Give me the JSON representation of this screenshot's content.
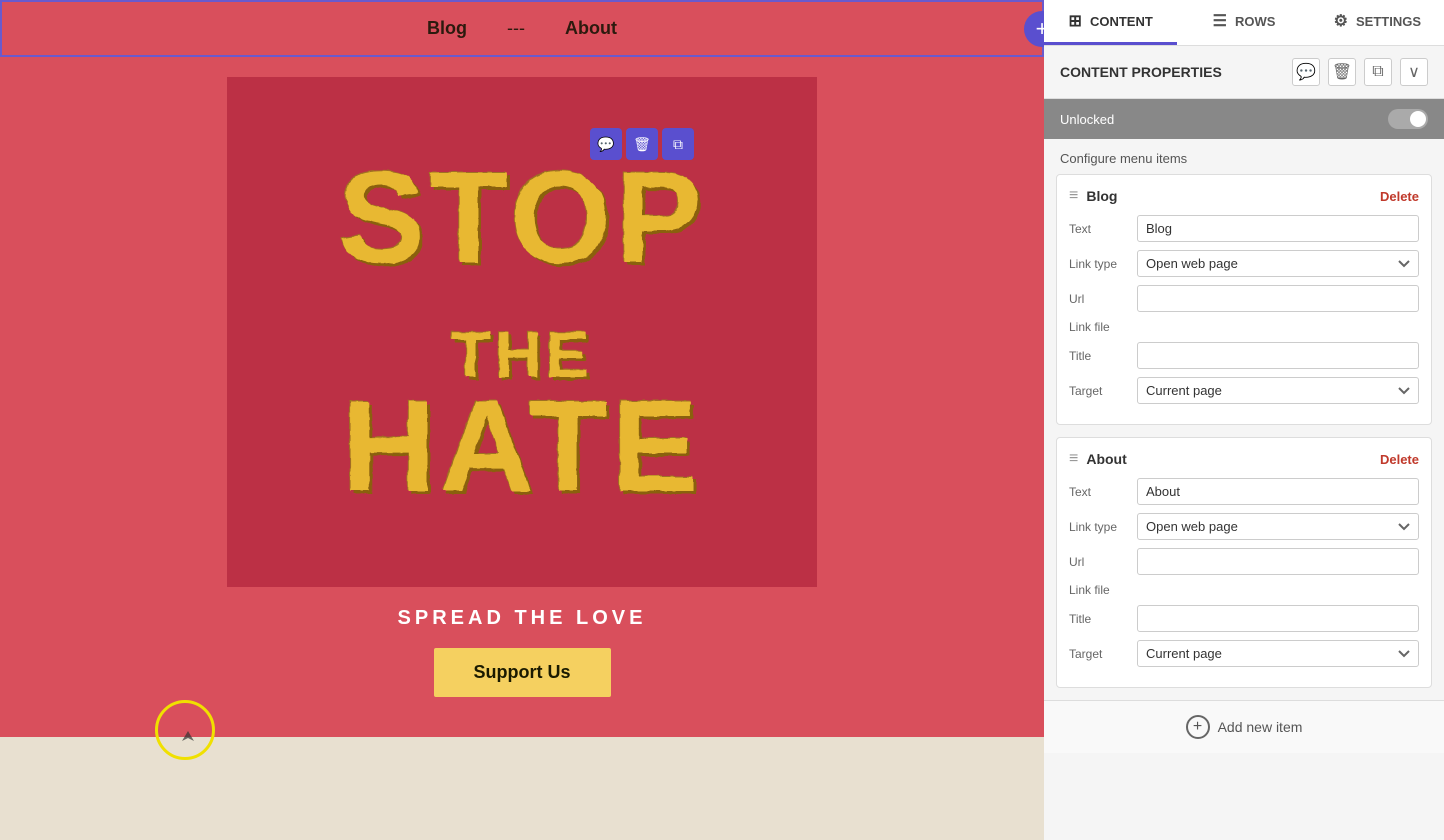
{
  "tabs": {
    "content": {
      "label": "CONTENT",
      "icon": "grid"
    },
    "rows": {
      "label": "ROWS",
      "icon": "rows"
    },
    "settings": {
      "label": "SETTINGS",
      "icon": "settings"
    }
  },
  "panel": {
    "title": "CONTENT PROPERTIES",
    "unlocked_label": "Unlocked",
    "configure_label": "Configure menu items",
    "actions": {
      "comment": "💬",
      "delete": "🗑",
      "copy": "⧉",
      "collapse": "∨"
    }
  },
  "menu_items": [
    {
      "id": "blog",
      "title": "Blog",
      "text_label": "Text",
      "text_value": "Blog",
      "link_type_label": "Link type",
      "link_type_value": "Open web page",
      "url_label": "Url",
      "url_value": "",
      "link_file_label": "Link file",
      "title_label": "Title",
      "title_value": "",
      "target_label": "Target",
      "target_value": "Current page",
      "delete_label": "Delete"
    },
    {
      "id": "about",
      "title": "About",
      "text_label": "Text",
      "text_value": "About",
      "link_type_label": "Link type",
      "link_type_value": "Open web page",
      "url_label": "Url",
      "url_value": "",
      "link_file_label": "Link file",
      "title_label": "Title",
      "title_value": "",
      "target_label": "Target",
      "target_value": "Current page",
      "delete_label": "Delete"
    }
  ],
  "add_new_label": "Add new item",
  "canvas": {
    "nav": {
      "blog": "Blog",
      "separator": "---",
      "about": "About"
    },
    "poster": {
      "line1": "STOP",
      "line2": "THE",
      "line3": "HATE",
      "small": "THE"
    },
    "spread_text": "SPREAD THE LOVE",
    "support_btn": "Support Us"
  }
}
